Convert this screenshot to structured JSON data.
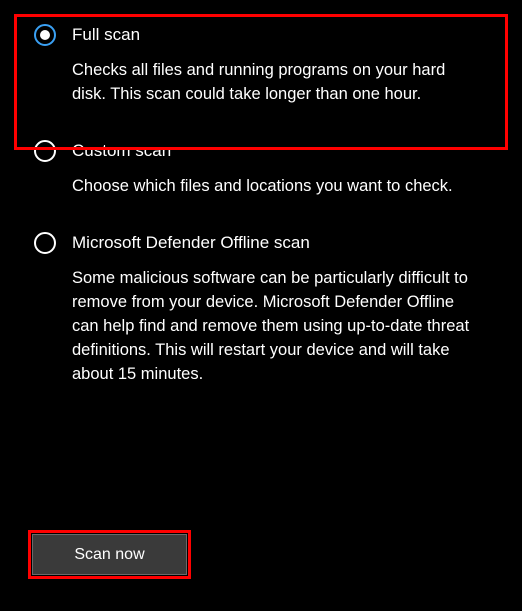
{
  "options": [
    {
      "title": "Full scan",
      "description": "Checks all files and running programs on your hard disk. This scan could take longer than one hour.",
      "selected": true
    },
    {
      "title": "Custom scan",
      "description": "Choose which files and locations you want to check.",
      "selected": false
    },
    {
      "title": "Microsoft Defender Offline scan",
      "description": "Some malicious software can be particularly difficult to remove from your device. Microsoft Defender Offline can help find and remove them using up-to-date threat definitions. This will restart your device and will take about 15 minutes.",
      "selected": false
    }
  ],
  "scan_button_label": "Scan now"
}
